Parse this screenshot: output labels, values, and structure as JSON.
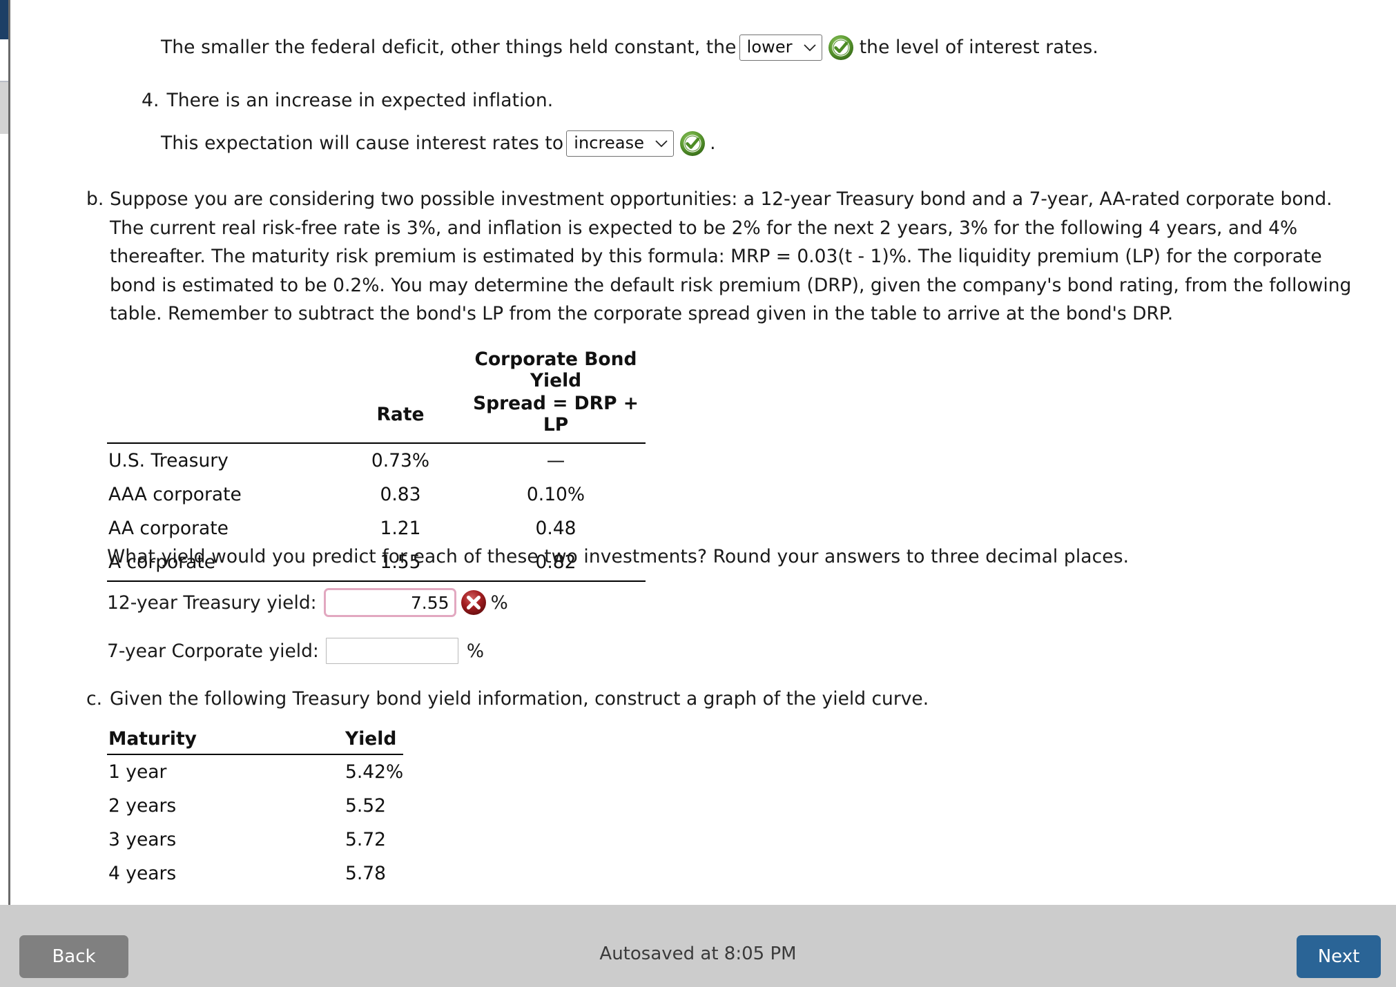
{
  "window": {
    "left_accent_color": "#1d3f66",
    "scrollbar_thumb_color": "#d3d3d3"
  },
  "question": {
    "deficit_statement_before": "The smaller the federal deficit, other things held constant, the",
    "deficit_statement_after": "the level of interest rates.",
    "deficit_select_value": "lower",
    "deficit_feedback_icon": "green-check-icon",
    "item4_number": "4.",
    "item4_text": "There is an increase in expected inflation.",
    "inflation_statement_before": "This expectation will cause interest rates to",
    "inflation_statement_after": ".",
    "inflation_select_value": "increase",
    "inflation_feedback_icon": "green-check-icon"
  },
  "part_b": {
    "marker": "b.",
    "text": "Suppose you are considering two possible investment opportunities: a 12-year Treasury bond and a 7-year, AA-rated corporate bond. The current real risk-free rate is 3%, and inflation is expected to be 2% for the next 2 years, 3% for the following 4 years, and 4% thereafter. The maturity risk premium is estimated by this formula: MRP = 0.03(t - 1)%. The liquidity premium (LP) for the corporate bond is estimated to be 0.2%. You may determine the default risk premium (DRP), given the company's bond rating, from the following table. Remember to subtract the bond's LP from the corporate spread given in the table to arrive at the bond's DRP.",
    "prompt": "What yield would you predict for each of these two investments? Round your answers to three decimal places."
  },
  "bond_table": {
    "group_header": "Corporate Bond Yield",
    "columns": [
      "",
      "Rate",
      "Spread = DRP + LP"
    ],
    "rows": [
      {
        "name": "U.S. Treasury",
        "rate": "0.73%",
        "spread": "—"
      },
      {
        "name": "AAA corporate",
        "rate": "0.83",
        "spread": "0.10%"
      },
      {
        "name": "AA corporate",
        "rate": "1.21",
        "spread": "0.48"
      },
      {
        "name": "A corporate",
        "rate": "1.55",
        "spread": "0.82"
      }
    ]
  },
  "answers": {
    "treasury_label": "12-year Treasury yield:",
    "treasury_value": "7.55",
    "treasury_unit": "%",
    "treasury_feedback_icon": "red-x-icon",
    "corporate_label": "7-year Corporate yield:",
    "corporate_value": "",
    "corporate_placeholder": "",
    "corporate_unit": "%"
  },
  "part_c": {
    "marker": "c.",
    "text": "Given the following Treasury bond yield information, construct a graph of the yield curve."
  },
  "maturity_table": {
    "columns": [
      "Maturity",
      "Yield"
    ],
    "rows": [
      {
        "maturity": "1 year",
        "yield": "5.42%"
      },
      {
        "maturity": "2 years",
        "yield": "5.52"
      },
      {
        "maturity": "3 years",
        "yield": "5.72"
      },
      {
        "maturity": "4 years",
        "yield": "5.78"
      }
    ]
  },
  "footer": {
    "back_label": "Back",
    "next_label": "Next",
    "autosave_text": "Autosaved at 8:05 PM",
    "back_color": "#808080",
    "next_color": "#2a6496",
    "bar_color": "#cccccc"
  }
}
